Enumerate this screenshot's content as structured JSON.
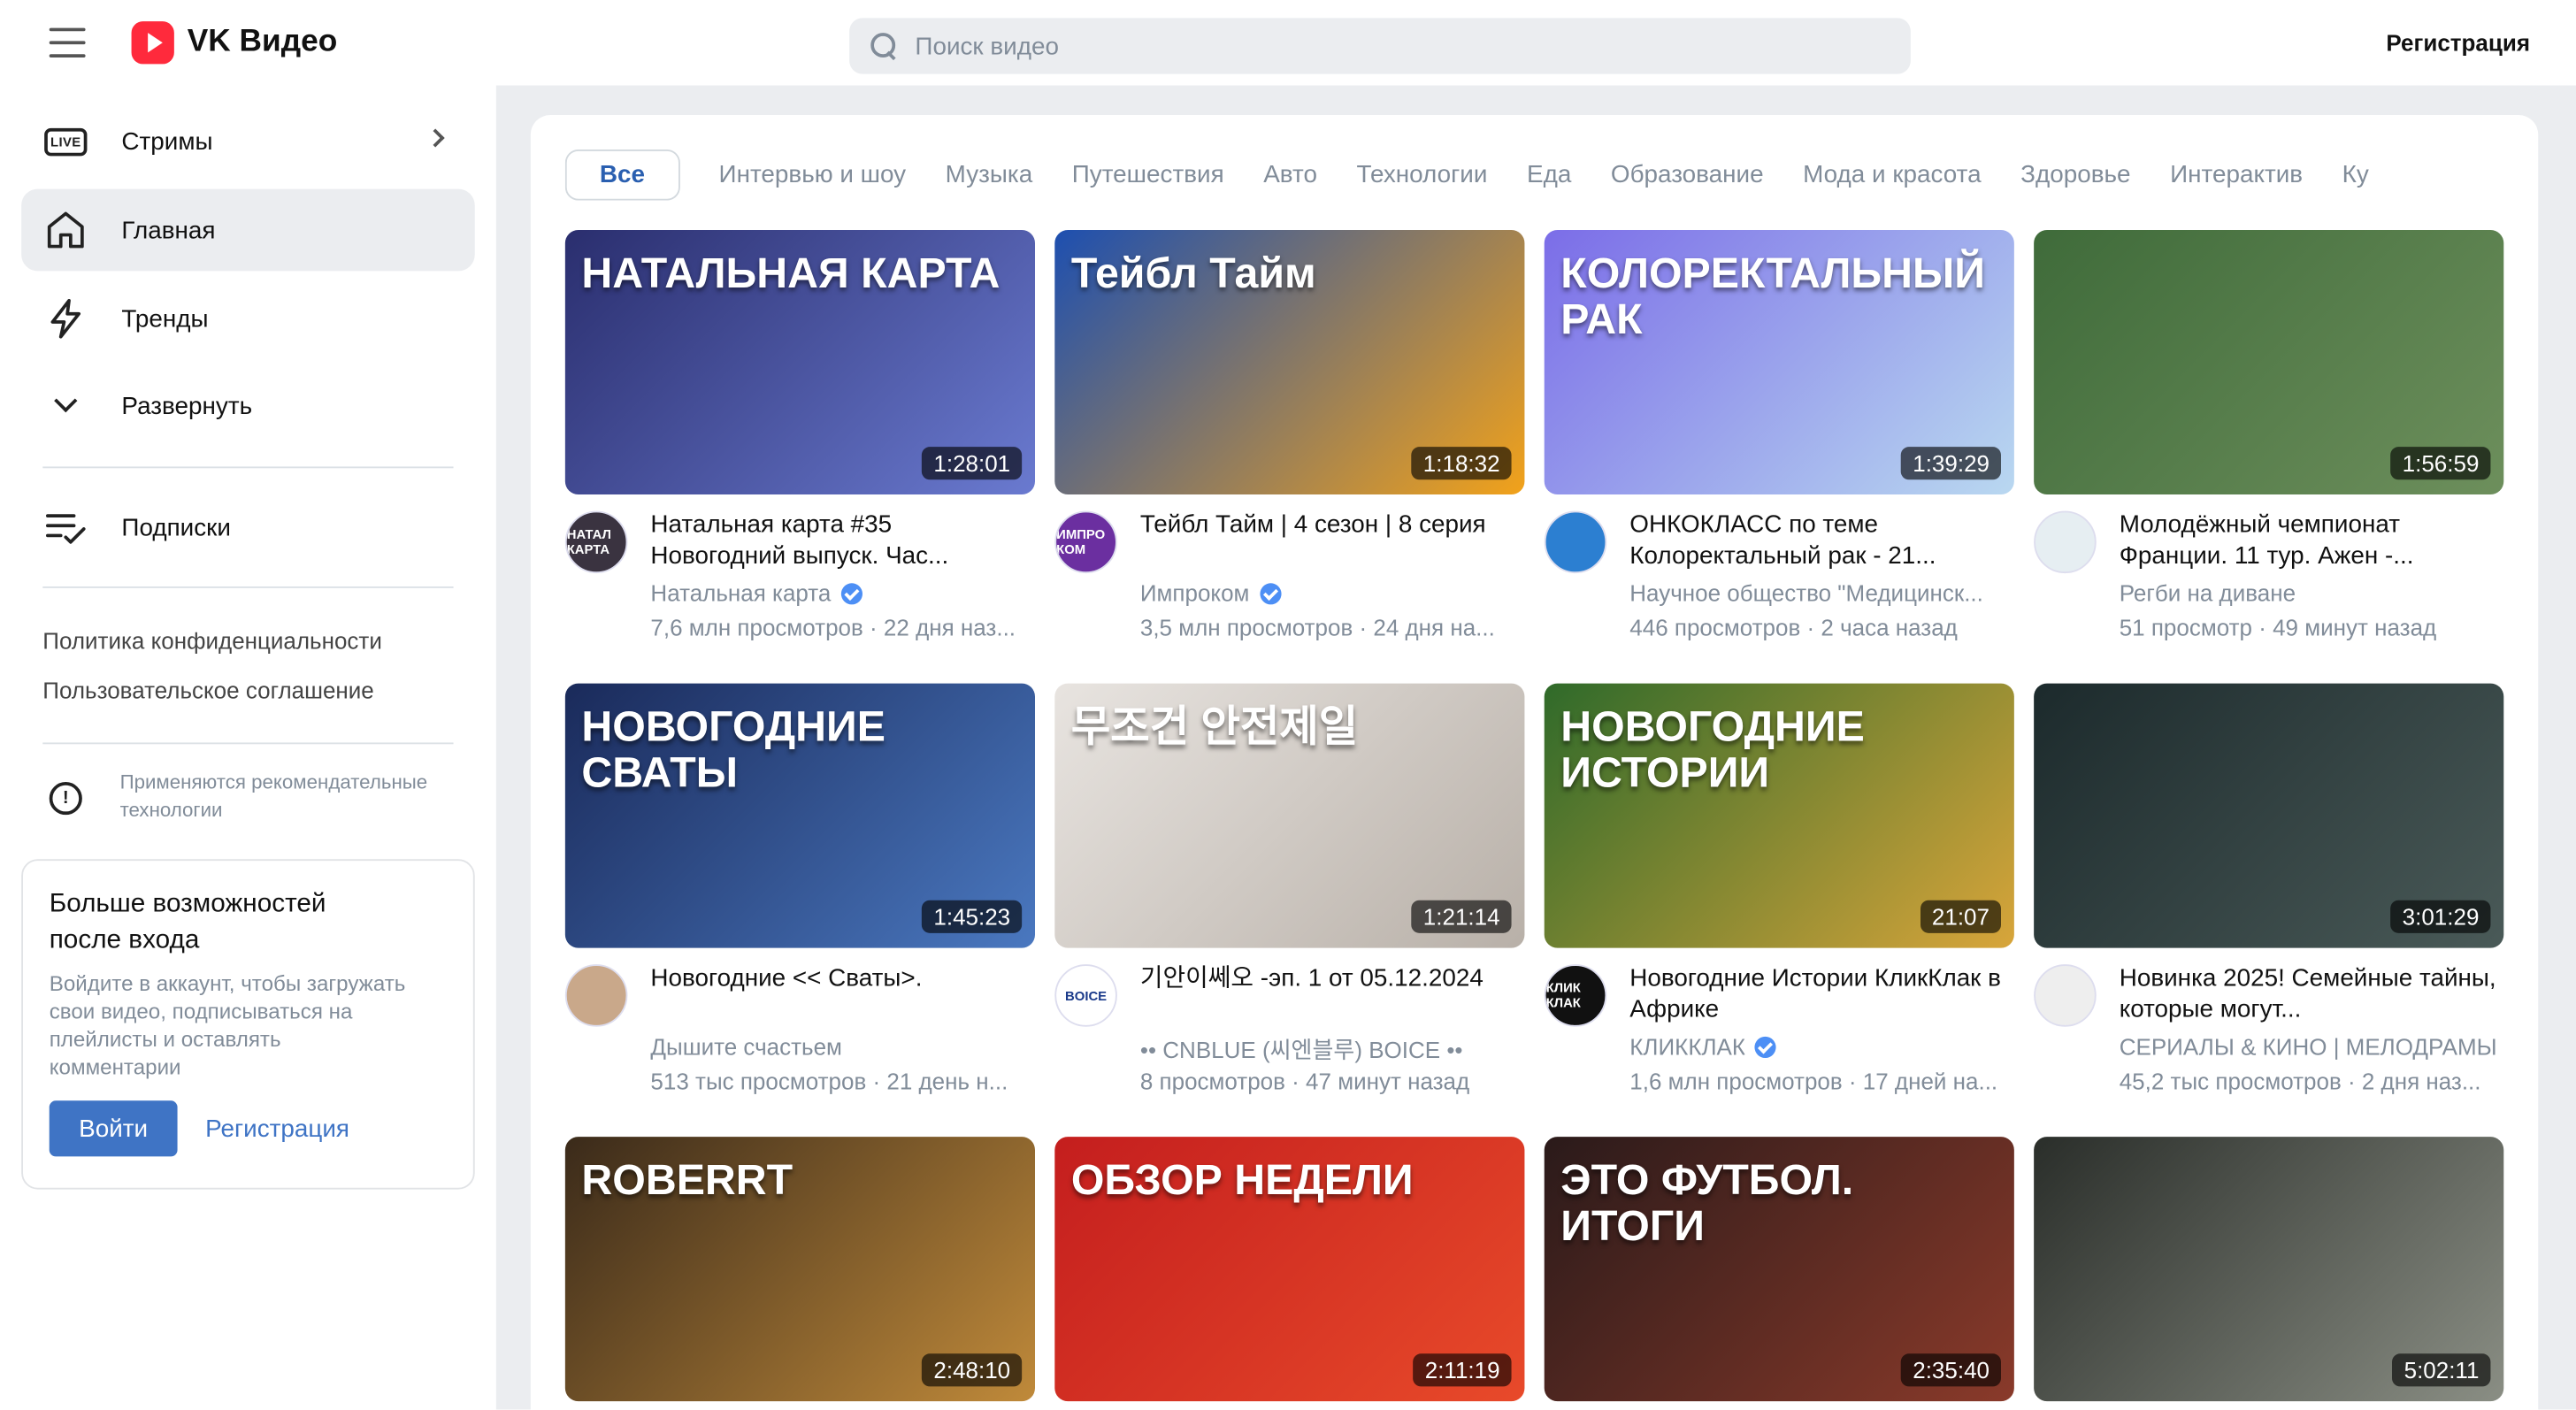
{
  "header": {
    "logo": "VK Видео",
    "search_placeholder": "Поиск видео",
    "register": "Регистрация"
  },
  "sidebar": {
    "items": [
      {
        "label": "Стримы",
        "icon": "live-icon"
      },
      {
        "label": "Главная",
        "icon": "home-icon"
      },
      {
        "label": "Тренды",
        "icon": "lightning-icon"
      },
      {
        "label": "Развернуть",
        "icon": "chevron-down-icon"
      },
      {
        "label": "Подписки",
        "icon": "subscriptions-icon"
      }
    ],
    "live_badge": "LIVE",
    "links": [
      "Политика конфиденциальности",
      "Пользовательское соглашение"
    ],
    "rec_icon": "!",
    "recommend": "Применяются рекомендательные технологии",
    "login": {
      "title": "Больше возможностей после входа",
      "desc": "Войдите в аккаунт, чтобы загружать свои видео, подписываться на плейлисты и оставлять комментарии",
      "login_btn": "Войти",
      "register_btn": "Регистрация"
    }
  },
  "categories": [
    "Все",
    "Интервью и шоу",
    "Музыка",
    "Путешествия",
    "Авто",
    "Технологии",
    "Еда",
    "Образование",
    "Мода и красота",
    "Здоровье",
    "Интерактив",
    "Ку"
  ],
  "videos": [
    {
      "title": "Натальная карта #35 Новогодний выпуск. Час...",
      "channel": "Натальная карта",
      "verified": true,
      "stats": "7,6 млн просмотров · 22 дня наз...",
      "duration": "1:28:01",
      "thumb_text": "НАТАЛЬНАЯ КАРТА",
      "avatar_text": "НАТАЛ КАРТА",
      "color_a": "#2a2e6e",
      "color_b": "#6a7ad0",
      "avatar_color": "#3a3340"
    },
    {
      "title": "Тейбл Тайм | 4 сезон | 8 серия",
      "channel": "Импроком",
      "verified": true,
      "stats": "3,5 млн просмотров · 24 дня на...",
      "duration": "1:18:32",
      "thumb_text": "Тейбл Тайм",
      "avatar_text": "ИМПРО КОМ",
      "color_a": "#1d4fb0",
      "color_b": "#f2a21a",
      "avatar_color": "#6b2fa0"
    },
    {
      "title": "ОНКОКЛАСС по теме Колоректальный рак - 21...",
      "channel": "Научное общество \"Медицинск...",
      "verified": false,
      "stats": "446 просмотров · 2 часа назад",
      "duration": "1:39:29",
      "thumb_text": "КОЛОРЕКТАЛЬНЫЙ РАК",
      "avatar_text": "",
      "color_a": "#7b6de8",
      "color_b": "#b9d8f0",
      "avatar_color": "#2c7fd1"
    },
    {
      "title": "Молодёжный чемпионат Франции. 11 тур. Ажен -...",
      "channel": "Регби на диване",
      "verified": false,
      "stats": "51 просмотр · 49 минут назад",
      "duration": "1:56:59",
      "thumb_text": "",
      "avatar_text": "",
      "color_a": "#3f6b3a",
      "color_b": "#6d8f5c",
      "avatar_color": "#e6eef2"
    },
    {
      "title": "Новогодние << Сваты>.",
      "channel": "Дышите счастьем",
      "verified": false,
      "stats": "513 тыс просмотров · 21 день н...",
      "duration": "1:45:23",
      "thumb_text": "НОВОГОДНИЕ СВАТЫ",
      "avatar_text": "",
      "color_a": "#1a2a5a",
      "color_b": "#4a78c0",
      "avatar_color": "#c9a88a"
    },
    {
      "title": "기안이쎄오 -эп. 1 от 05.12.2024",
      "channel": "•• CNBLUE (씨엔블루) BOICE ••",
      "verified": false,
      "stats": "8 просмотров · 47 минут назад",
      "duration": "1:21:14",
      "thumb_text": "무조건 안전제일",
      "avatar_text": "BOICE",
      "color_a": "#e8e4e0",
      "color_b": "#b8b0a8",
      "avatar_color": "#ffffff"
    },
    {
      "title": "Новогодние Истории КликКлак в Африке",
      "channel": "КЛИККЛАК",
      "verified": true,
      "stats": "1,6 млн просмотров · 17 дней на...",
      "duration": "21:07",
      "thumb_text": "НОВОГОДНИЕ ИСТОРИИ",
      "avatar_text": "КЛИК КЛАК",
      "color_a": "#2f6a2a",
      "color_b": "#d8a53a",
      "avatar_color": "#111111"
    },
    {
      "title": "Новинка 2025! Семейные тайны, которые могут...",
      "channel": "СЕРИАЛЫ & КИНО | МЕЛОДРАМЫ",
      "verified": false,
      "stats": "45,2 тыс просмотров · 2 дня наз...",
      "duration": "3:01:29",
      "thumb_text": "",
      "avatar_text": "",
      "color_a": "#1c2a2c",
      "color_b": "#4a5a58",
      "avatar_color": "#eeeeee"
    },
    {
      "title": "",
      "channel": "",
      "verified": false,
      "stats": "",
      "duration": "2:48:10",
      "thumb_text": "ROBERRT",
      "avatar_text": "",
      "color_a": "#3a2a1a",
      "color_b": "#c08a3a",
      "avatar_color": "#ffffff"
    },
    {
      "title": "",
      "channel": "",
      "verified": false,
      "stats": "",
      "duration": "2:11:19",
      "thumb_text": "ОБЗОР НЕДЕЛИ",
      "avatar_text": "",
      "color_a": "#c41e1e",
      "color_b": "#e84a2a",
      "avatar_color": "#ffffff"
    },
    {
      "title": "",
      "channel": "",
      "verified": false,
      "stats": "",
      "duration": "2:35:40",
      "thumb_text": "ЭТО ФУТБОЛ. ИТОГИ",
      "avatar_text": "",
      "color_a": "#2a1a1a",
      "color_b": "#8a3a2a",
      "avatar_color": "#ffffff"
    },
    {
      "title": "",
      "channel": "",
      "verified": false,
      "stats": "",
      "duration": "5:02:11",
      "thumb_text": "",
      "avatar_text": "",
      "color_a": "#2a2e2a",
      "color_b": "#8a8e84",
      "avatar_color": "#ffffff"
    }
  ]
}
